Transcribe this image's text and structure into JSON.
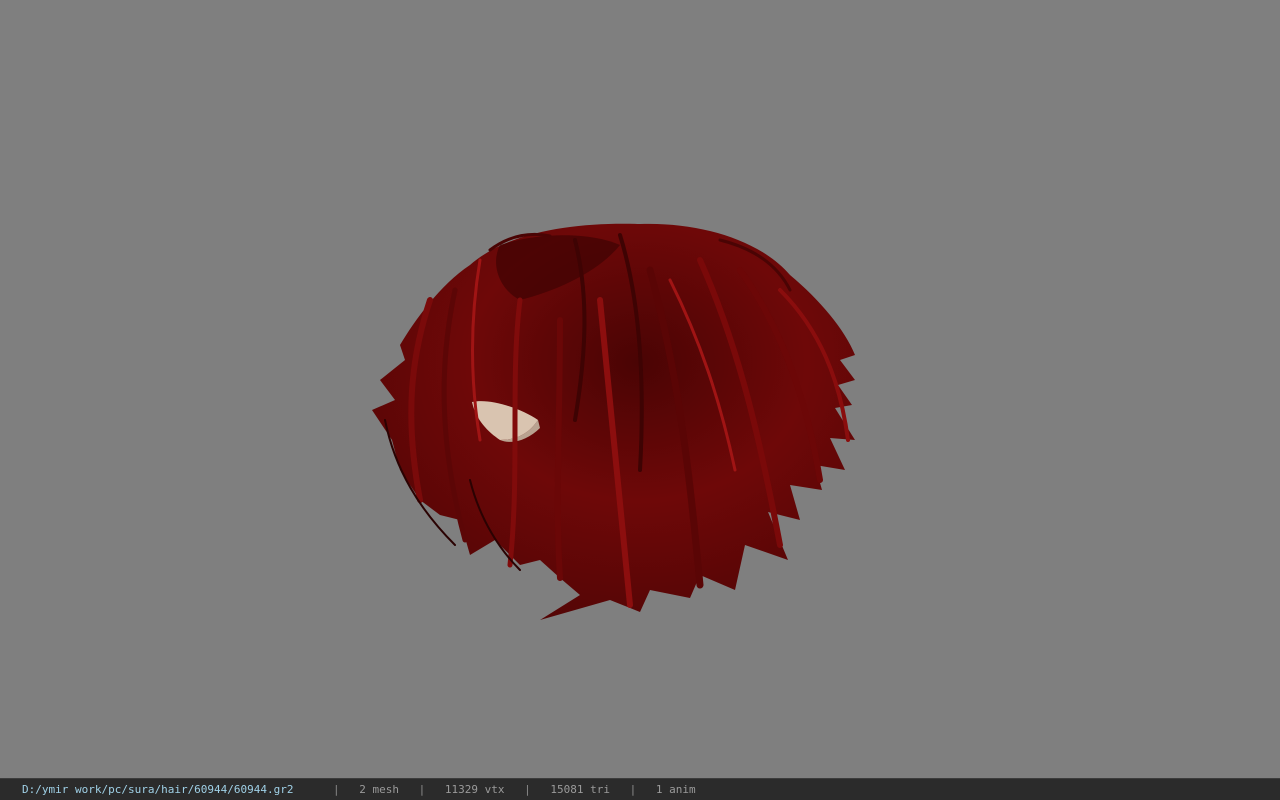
{
  "viewport": {
    "background_color": "#7f7f7f",
    "model": {
      "subject": "hair-mesh",
      "hair_color": "#6a0707",
      "skin_color": "#d9c4b0"
    }
  },
  "statusbar": {
    "file_path": "D:/ymir work/pc/sura/hair/60944/60944.gr2",
    "separator": "|",
    "mesh_count": "2 mesh",
    "vertex_count": "11329 vtx",
    "triangle_count": "15081 tri",
    "anim_count": "1 anim",
    "path_color": "#9fd0e6",
    "text_color": "#9a9a9a"
  }
}
